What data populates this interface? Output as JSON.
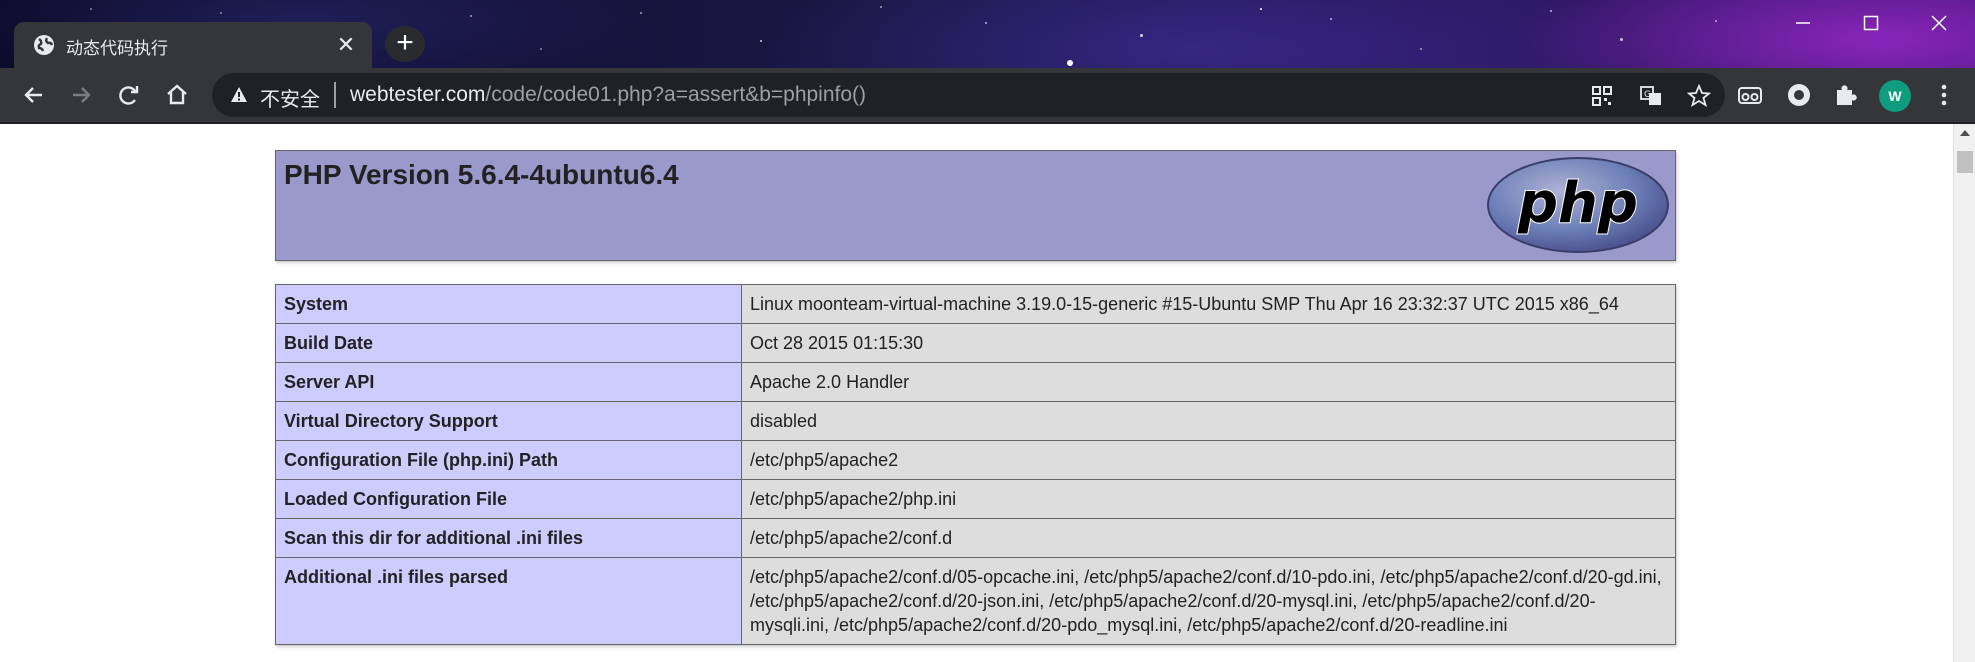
{
  "browser": {
    "tab_title": "动态代码执行",
    "new_tab_label": "+",
    "security_label": "不安全",
    "url_host": "webtester.com",
    "url_path": "/code/code01.php?a=assert&b=phpinfo()",
    "profile_initial": "W",
    "accent_color": "#0f9d80"
  },
  "page": {
    "php_version_heading": "PHP Version 5.6.4-4ubuntu6.4",
    "logo_text": "php",
    "info_rows": [
      {
        "key": "System",
        "value": "Linux moonteam-virtual-machine 3.19.0-15-generic #15-Ubuntu SMP Thu Apr 16 23:32:37 UTC 2015 x86_64"
      },
      {
        "key": "Build Date",
        "value": "Oct 28 2015 01:15:30"
      },
      {
        "key": "Server API",
        "value": "Apache 2.0 Handler"
      },
      {
        "key": "Virtual Directory Support",
        "value": "disabled"
      },
      {
        "key": "Configuration File (php.ini) Path",
        "value": "/etc/php5/apache2"
      },
      {
        "key": "Loaded Configuration File",
        "value": "/etc/php5/apache2/php.ini"
      },
      {
        "key": "Scan this dir for additional .ini files",
        "value": "/etc/php5/apache2/conf.d"
      },
      {
        "key": "Additional .ini files parsed",
        "value": "/etc/php5/apache2/conf.d/05-opcache.ini, /etc/php5/apache2/conf.d/10-pdo.ini, /etc/php5/apache2/conf.d/20-gd.ini, /etc/php5/apache2/conf.d/20-json.ini, /etc/php5/apache2/conf.d/20-mysql.ini, /etc/php5/apache2/conf.d/20-mysqli.ini, /etc/php5/apache2/conf.d/20-pdo_mysql.ini, /etc/php5/apache2/conf.d/20-readline.ini"
      }
    ]
  }
}
